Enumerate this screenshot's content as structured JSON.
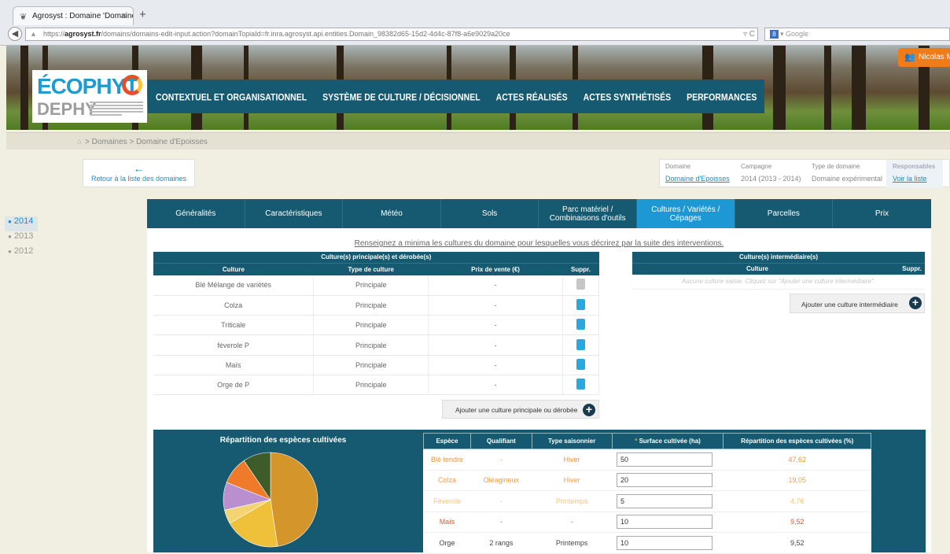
{
  "browser": {
    "tab_title": "Agrosyst : Domaine 'Domaine ...",
    "tab_close": "×",
    "new_tab": "+",
    "url_prefix": "https://",
    "url_host": "agrosyst.fr",
    "url_path": "/domains/domains-edit-input.action?domainTopiaId=fr.inra.agrosyst.api.entities.Domain_98382d65-15d2-4d4c-87f8-a6e9029a20ce",
    "search_placeholder": "Google",
    "search_engine_badge": "8"
  },
  "header": {
    "logo_top": "ÉCOPHYT",
    "logo_bottom": "DEPHY",
    "nav": [
      "CONTEXTUEL ET ORGANISATIONNEL",
      "SYSTÈME DE CULTURE / DÉCISIONNEL",
      "ACTES RÉALISÉS",
      "ACTES SYNTHÉTISÉS",
      "PERFORMANCES"
    ],
    "user_name": "Nicolas M"
  },
  "breadcrumb": {
    "text": "> Domaines > Domaine d'Epoisses"
  },
  "back": {
    "arrow": "←",
    "label": "Retour à la liste des domaines"
  },
  "info": {
    "domaine_label": "Domaine",
    "domaine_value": "Domaine d'Epoisses",
    "campagne_label": "Campagne",
    "campagne_value": "2014 (2013 - 2014)",
    "type_label": "Type de domaine",
    "type_value": "Domaine expérimental",
    "resp_label": "Responsables",
    "resp_value": "Voir la liste"
  },
  "years": [
    "2014",
    "2013",
    "2012"
  ],
  "subtabs": [
    "Généralités",
    "Caractéristiques",
    "Météo",
    "Sols",
    "Parc matériel / Combinaisons d'outils",
    "Cultures / Variétés / Cépages",
    "Parcelles",
    "Prix"
  ],
  "intro": "Renseignez a minima les cultures du domaine pour lesquelles vous décrirez par la suite des interventions.",
  "main_crops": {
    "caption": "Culture(s) principale(s) et dérobée(s)",
    "headers": [
      "Culture",
      "Type de culture",
      "Prix de vente (€)",
      "Suppr."
    ],
    "rows": [
      {
        "culture": "Blé Mélange de variétés",
        "type": "Principale",
        "prix": "-",
        "deletable": false
      },
      {
        "culture": "Colza",
        "type": "Principale",
        "prix": "-",
        "deletable": true
      },
      {
        "culture": "Triticale",
        "type": "Principale",
        "prix": "-",
        "deletable": true
      },
      {
        "culture": "féverole P",
        "type": "Principale",
        "prix": "-",
        "deletable": true
      },
      {
        "culture": "Maïs",
        "type": "Principale",
        "prix": "-",
        "deletable": true
      },
      {
        "culture": "Orge de P",
        "type": "Principale",
        "prix": "-",
        "deletable": true
      }
    ],
    "add_label": "Ajouter une culture principale ou dérobée"
  },
  "intermediate": {
    "caption": "Culture(s) intermédiaire(s)",
    "headers": [
      "Culture",
      "Suppr."
    ],
    "empty": "Aucune culture saisie. Cliquez sur \"Ajouter une culture intermédiaire\".",
    "add_label": "Ajouter une culture intermédiaire"
  },
  "stats": {
    "title": "Répartition des espèces cultivées",
    "headers": [
      "Espèce",
      "Qualifiant",
      "Type saisonnier",
      "Surface cultivée (ha)",
      "Répartition des espèces cultivées (%)"
    ],
    "required_mark": "*",
    "rows": [
      {
        "espece": "Blé tendre",
        "qualifiant": "-",
        "saison": "Hiver",
        "surface": "50",
        "pct": "47,62",
        "color": "#e8963a"
      },
      {
        "espece": "Colza",
        "qualifiant": "Oléagineux",
        "saison": "Hiver",
        "surface": "20",
        "pct": "19,05",
        "color": "#f0a050"
      },
      {
        "espece": "Féverole",
        "qualifiant": "-",
        "saison": "Printemps",
        "surface": "5",
        "pct": "4,76",
        "color": "#f5c867"
      },
      {
        "espece": "Maïs",
        "qualifiant": "-",
        "saison": "-",
        "surface": "10",
        "pct": "9,52",
        "color": "#e25a2a"
      },
      {
        "espece": "Orge",
        "qualifiant": "2 rangs",
        "saison": "Printemps",
        "surface": "10",
        "pct": "9,52",
        "color": "#444444"
      }
    ],
    "pie_colors": [
      "#d4952a",
      "#efc13a",
      "#f2d572",
      "#b98fcf",
      "#ef7a2a",
      "#3e5b2a"
    ]
  }
}
